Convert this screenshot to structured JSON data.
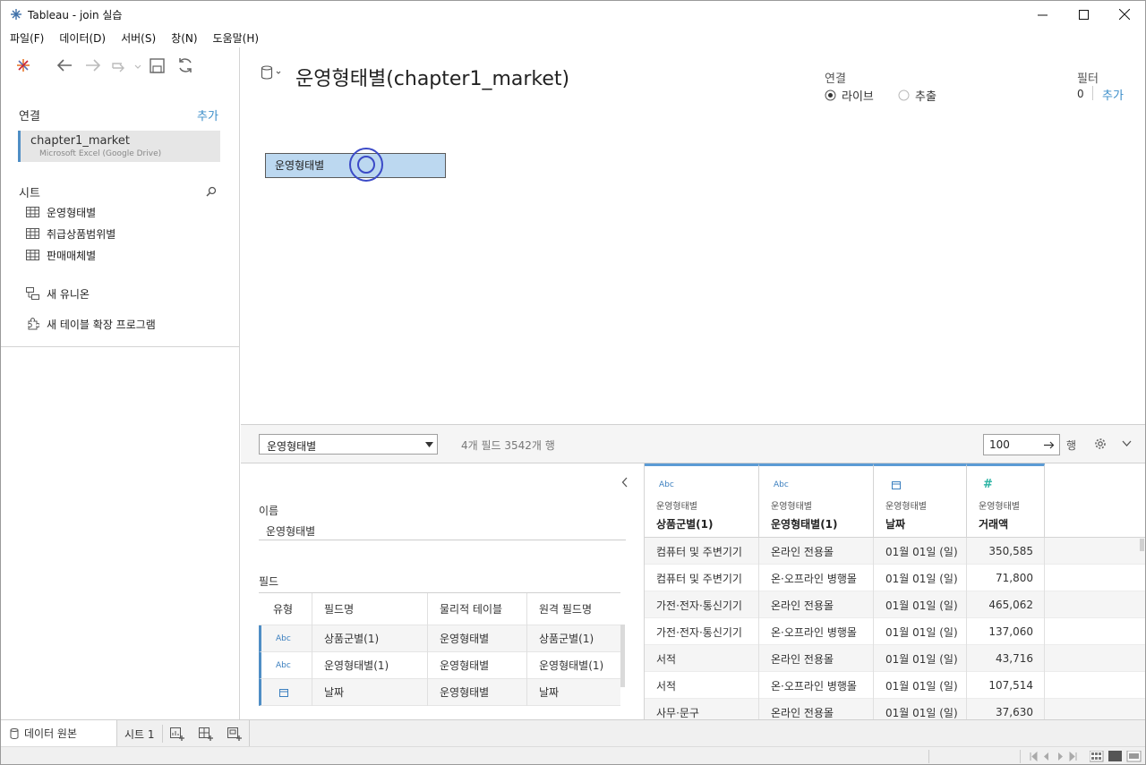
{
  "window": {
    "title": "Tableau - join 실습"
  },
  "menu": [
    "파일(F)",
    "데이터(D)",
    "서버(S)",
    "창(N)",
    "도움말(H)"
  ],
  "left": {
    "connections_title": "연결",
    "add_label": "추가",
    "connection": {
      "name": "chapter1_market",
      "sub": "Microsoft Excel (Google Drive)"
    },
    "sheets_title": "시트",
    "sheets": [
      "운영형태별",
      "취급상품범위별",
      "판매매체별"
    ],
    "new_union": "새 유니온",
    "new_extension": "새 테이블 확장 프로그램"
  },
  "canvas": {
    "datasource_title": "운영형태별(chapter1_market)",
    "connection_label": "연결",
    "live_label": "라이브",
    "extract_label": "추출",
    "filter_label": "필터",
    "filter_count": "0",
    "filter_add": "추가",
    "table_name": "운영형태별"
  },
  "gridbar": {
    "table_select": "운영형태별",
    "info": "4개 필드 3542개 행",
    "rows_value": "100",
    "rows_label": "행"
  },
  "meta": {
    "name_label": "이름",
    "name_value": "운영형태별",
    "fields_label": "필드",
    "headers": [
      "유형",
      "필드명",
      "물리적 테이블",
      "원격 필드명"
    ],
    "rows": [
      {
        "type": "Abc",
        "field": "상품군별(1)",
        "table": "운영형태별",
        "remote": "상품군별(1)"
      },
      {
        "type": "Abc",
        "field": "운영형태별(1)",
        "table": "운영형태별",
        "remote": "운영형태별(1)"
      },
      {
        "type": "date",
        "field": "날짜",
        "table": "운영형태별",
        "remote": "날짜"
      }
    ]
  },
  "grid": {
    "columns": [
      {
        "type": "Abc",
        "source": "운영형태별",
        "name": "상품군별(1)"
      },
      {
        "type": "Abc",
        "source": "운영형태별",
        "name": "운영형태별(1)"
      },
      {
        "type": "date",
        "source": "운영형태별",
        "name": "날짜"
      },
      {
        "type": "#",
        "source": "운영형태별",
        "name": "거래액"
      }
    ],
    "rows": [
      [
        "컴퓨터 및 주변기기",
        "온라인 전용몰",
        "01월 01일 (일)",
        "350,585"
      ],
      [
        "컴퓨터 및 주변기기",
        "온·오프라인 병행몰",
        "01월 01일 (일)",
        "71,800"
      ],
      [
        "가전·전자·통신기기",
        "온라인 전용몰",
        "01월 01일 (일)",
        "465,062"
      ],
      [
        "가전·전자·통신기기",
        "온·오프라인 병행몰",
        "01월 01일 (일)",
        "137,060"
      ],
      [
        "서적",
        "온라인 전용몰",
        "01월 01일 (일)",
        "43,716"
      ],
      [
        "서적",
        "온·오프라인 병행몰",
        "01월 01일 (일)",
        "107,514"
      ],
      [
        "사무·문구",
        "온라인 전용몰",
        "01월 01일 (일)",
        "37,630"
      ]
    ]
  },
  "tabs": {
    "datasource": "데이터 원본",
    "sheet1": "시트 1"
  },
  "colors": {
    "accent": "#4f8ec5",
    "link": "#3b8ec9",
    "table_fill": "#bcd8f0",
    "ring": "#3b4ac7"
  }
}
